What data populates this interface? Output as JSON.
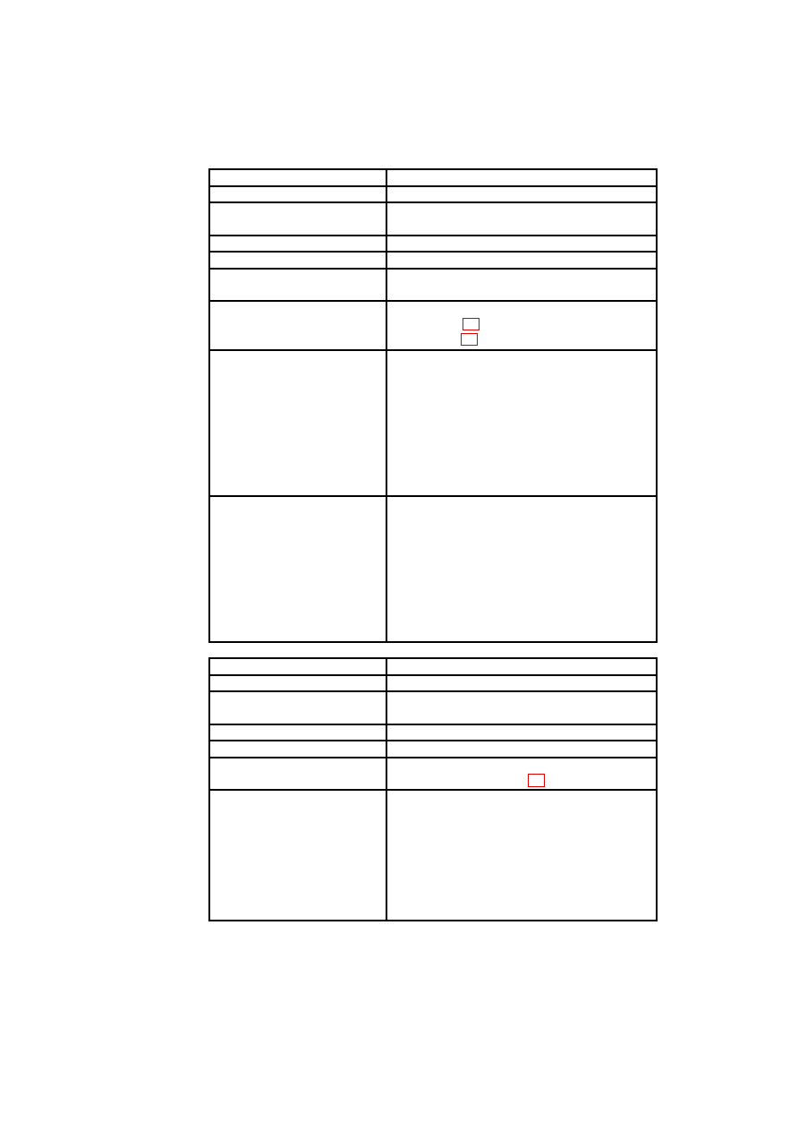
{
  "tables": [
    {
      "rows": [
        {
          "label": "",
          "value": ""
        },
        {
          "label": "",
          "value": ""
        },
        {
          "label": "",
          "value": ""
        },
        {
          "label": "",
          "value": ""
        },
        {
          "label": "",
          "value": ""
        },
        {
          "label": "",
          "value": ""
        },
        {
          "label": "",
          "value": "",
          "marks": 2
        },
        {
          "label": "",
          "value": ""
        },
        {
          "label": "",
          "value": ""
        }
      ]
    },
    {
      "rows": [
        {
          "label": "",
          "value": ""
        },
        {
          "label": "",
          "value": ""
        },
        {
          "label": "",
          "value": ""
        },
        {
          "label": "",
          "value": ""
        },
        {
          "label": "",
          "value": ""
        },
        {
          "label": "",
          "value": "",
          "marks": 1
        },
        {
          "label": "",
          "value": ""
        }
      ]
    }
  ],
  "colors": {
    "border": "#000000",
    "mark": "#e00000",
    "background": "#ffffff"
  }
}
